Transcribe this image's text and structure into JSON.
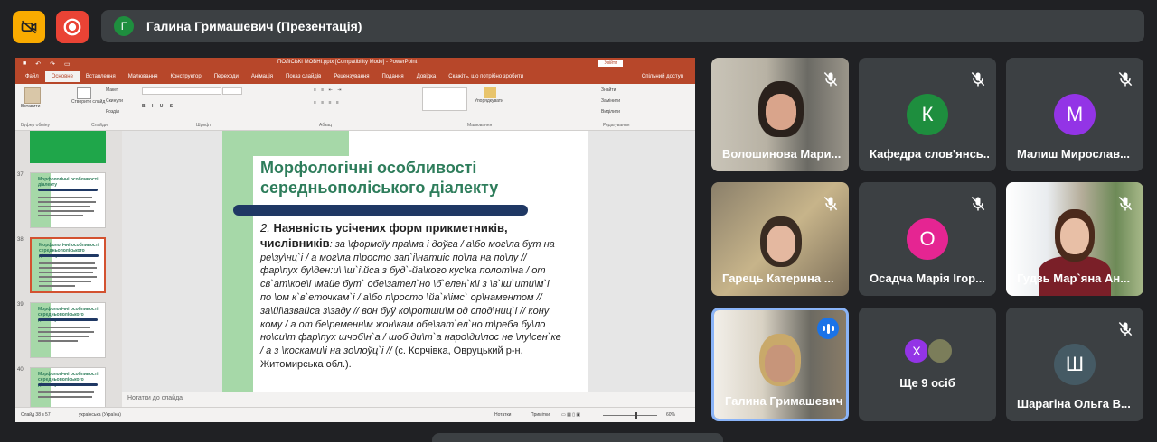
{
  "presenter": {
    "initial": "Г",
    "label": "Галина Гримашевич (Презентація)"
  },
  "ppt": {
    "doc_title": "ПОЛІСЬКІ МОВНІ.pptx [Compatibility Mode] - PowerPoint",
    "sign_in": "Увійти",
    "tabs": [
      "Файл",
      "Основне",
      "Вставлення",
      "Малювання",
      "Конструктор",
      "Переходи",
      "Анімація",
      "Показ слайдів",
      "Рецензування",
      "Подання",
      "Довідка",
      "Скажіть, що потрібно зробити"
    ],
    "share": "Спільний доступ",
    "ribbon": {
      "paste": "Вставити",
      "new_slide": "Створити слайд",
      "layout": "Макет",
      "reset": "Скинути",
      "section": "Розділ",
      "clipboard": "Буфер обміну",
      "slides": "Слайди",
      "font": "Шрифт",
      "paragraph": "Абзац",
      "drawing": "Малювання",
      "arrange": "Упорядкувати",
      "find": "Знайти",
      "replace": "Замінити",
      "select": "Виділити",
      "editing": "Редагування"
    },
    "thumbnails": [
      {
        "num": "37",
        "title": "Морфологічні особливості діалекту",
        "selected": false
      },
      {
        "num": "38",
        "title": "Морфологічні особливості середньополіського діалекту",
        "selected": true
      },
      {
        "num": "39",
        "title": "Морфологічні особливості середньополіського діалекту",
        "selected": false
      },
      {
        "num": "40",
        "title": "Морфологічні особливості середньополіського діалекту",
        "selected": false
      }
    ],
    "slide": {
      "title_line1": "Морфологічні особливості",
      "title_line2": "середньополіського діалекту",
      "lead_num": "2.",
      "lead": "Наявність усічених форм прикметників, числівників",
      "body": ": за \\формоїу пра\\ма і доўга / а\\бо мог\\ла бут на ре\\зу\\нц`і / а мог\\ла п\\росто зап`і\\натиіс по\\ла на по\\лу // фар\\пух бу\\ден:и\\ \\ш`і\\йса з буд`-йа\\кого кус\\ка полот\\на / от св`ат\\кое\\і \\майе бут` обе\\зател`но \\б`елен`к\\і з \\в`іш`ити\\м`і по \\ом к`в`еточкам`і / а\\бо п\\росто \\йа`к\\імс` ор\\наментом // за\\йі\\азвайса з\\заду // вон буў ко\\ротши\\м од спод\\ниц`і // кону кому / а от бе\\ременн\\м жон\\кам обе\\зат`ел`но т\\реба бу\\ло но\\си\\т фар\\пух шчоб\\н`а / шоб ди\\т`а наро\\ди\\лос не \\лу\\сен`ке / а з \\косками\\і на зо\\лоўц`і //",
      "source": " (с. Корчівка, Овруцький р-н, Житомирська обл.)."
    },
    "notes_placeholder": "Нотатки до слайда",
    "status": {
      "slide_counter": "Слайд 38 з 57",
      "language": "українська (Україна)",
      "notes": "Нотатки",
      "comments": "Примітки",
      "zoom": "60%"
    }
  },
  "participants": [
    {
      "name": "Волошинова Мари...",
      "type": "video",
      "muted": true
    },
    {
      "name": "Кафедра слов'янсь...",
      "type": "avatar",
      "initial": "К",
      "color": "#1e8e3e",
      "muted": true
    },
    {
      "name": "Малиш Мирослав...",
      "type": "avatar",
      "initial": "М",
      "color": "#9334e6",
      "muted": true
    },
    {
      "name": "Гарець Катерина ...",
      "type": "video",
      "muted": true
    },
    {
      "name": "Осадча Марія Ігор...",
      "type": "avatar",
      "initial": "О",
      "color": "#e52592",
      "muted": true
    },
    {
      "name": "Гудзь Мар`яна Ан...",
      "type": "video",
      "muted": true
    },
    {
      "name": "Галина Гримашевич",
      "type": "video",
      "muted": false,
      "speaking": true
    },
    {
      "name": "Ще 9 осіб",
      "type": "others",
      "initial": "Х",
      "color": "#9334e6"
    },
    {
      "name": "Шарагіна Ольга В...",
      "type": "avatar",
      "initial": "Ш",
      "color": "#455a64",
      "muted": true
    }
  ],
  "icons": {
    "camera_off": "camera-off-icon",
    "record": "record-icon",
    "mic_off": "mic-off-icon",
    "speaking": "speaking-indicator-icon"
  },
  "colors": {
    "ppt_accent": "#b7472a",
    "slide_title": "#2e7d5b",
    "slide_bar": "#1f3864",
    "slide_green": "#a6d8a8",
    "meet_bg": "#202124",
    "tile_bg": "#3c4043",
    "active_border": "#8ab4f8"
  }
}
